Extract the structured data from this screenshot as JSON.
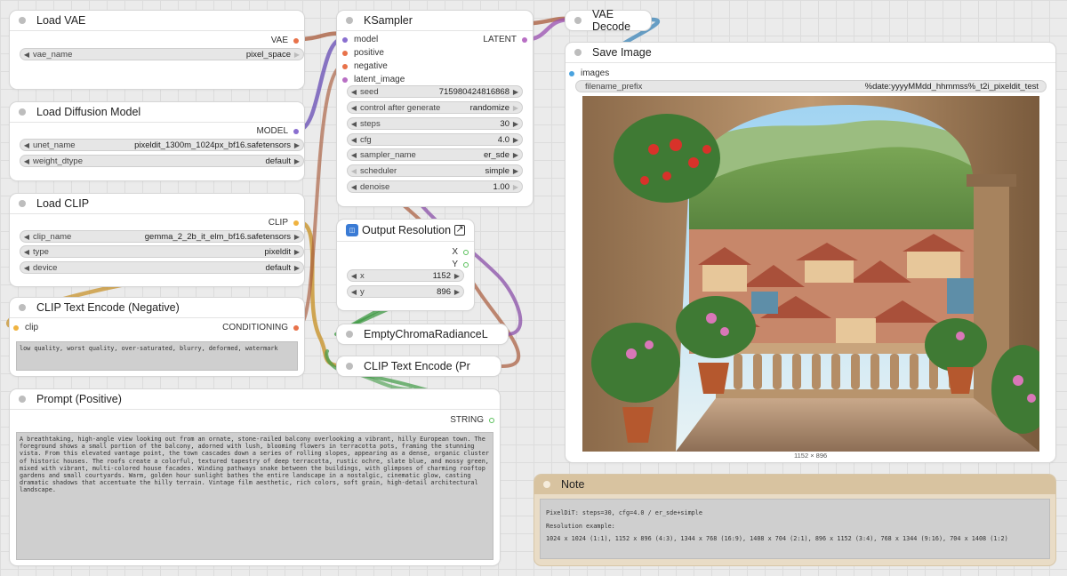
{
  "nodes": {
    "load_vae": {
      "title": "Load VAE",
      "outputs": [
        {
          "label": "VAE",
          "color": "#e8724a"
        }
      ],
      "widgets": [
        {
          "label": "vae_name",
          "value": "pixel_space"
        }
      ]
    },
    "load_diffusion_model": {
      "title": "Load Diffusion Model",
      "outputs": [
        {
          "label": "MODEL",
          "color": "#8a6fd0"
        }
      ],
      "widgets": [
        {
          "label": "unet_name",
          "value": "pixeldit_1300m_1024px_bf16.safetensors"
        },
        {
          "label": "weight_dtype",
          "value": "default"
        }
      ]
    },
    "load_clip": {
      "title": "Load CLIP",
      "outputs": [
        {
          "label": "CLIP",
          "color": "#f0b340"
        }
      ],
      "widgets": [
        {
          "label": "clip_name",
          "value": "gemma_2_2b_it_elm_bf16.safetensors"
        },
        {
          "label": "type",
          "value": "pixeldit"
        },
        {
          "label": "device",
          "value": "default"
        }
      ]
    },
    "clip_text_encode_negative": {
      "title": "CLIP Text Encode (Negative)",
      "inputs": [
        {
          "label": "clip",
          "color": "#f0b340"
        }
      ],
      "outputs": [
        {
          "label": "CONDITIONING",
          "color": "#e8724a"
        }
      ],
      "text": "low quality, worst quality, over-saturated, blurry, deformed, watermark"
    },
    "prompt_positive": {
      "title": "Prompt (Positive)",
      "outputs": [
        {
          "label": "STRING",
          "color": "#59c05a"
        }
      ],
      "text": "A breathtaking, high-angle view looking out from an ornate, stone-railed balcony overlooking a vibrant, hilly European town. The foreground shows a small portion of the balcony, adorned with lush, blooming flowers in terracotta pots, framing the stunning vista. From this elevated vantage point, the town cascades down a series of rolling slopes, appearing as a dense, organic cluster of historic houses. The roofs create a colorful, textured tapestry of deep terracotta, rustic ochre, slate blue, and mossy green, mixed with vibrant, multi-colored house facades. Winding pathways snake between the buildings, with glimpses of charming rooftop gardens and small courtyards. Warm, golden hour sunlight bathes the entire landscape in a nostalgic, cinematic glow, casting dramatic shadows that accentuate the hilly terrain. Vintage film aesthetic, rich colors, soft grain, high-detail architectural landscape."
    },
    "ksampler": {
      "title": "KSampler",
      "inputs": [
        {
          "label": "model",
          "color": "#8a6fd0"
        },
        {
          "label": "positive",
          "color": "#e8724a"
        },
        {
          "label": "negative",
          "color": "#e8724a"
        },
        {
          "label": "latent_image",
          "color": "#b86fc4"
        }
      ],
      "outputs": [
        {
          "label": "LATENT",
          "color": "#b86fc4"
        }
      ],
      "widgets": [
        {
          "label": "seed",
          "value": "715980424816868"
        },
        {
          "label": "control after generate",
          "value": "randomize"
        },
        {
          "label": "steps",
          "value": "30"
        },
        {
          "label": "cfg",
          "value": "4.0"
        },
        {
          "label": "sampler_name",
          "value": "er_sde"
        },
        {
          "label": "scheduler",
          "value": "simple"
        },
        {
          "label": "denoise",
          "value": "1.00"
        }
      ]
    },
    "output_resolution": {
      "title": "Output Resolution",
      "outputs": [
        {
          "label": "X",
          "color": "#59c05a"
        },
        {
          "label": "Y",
          "color": "#59c05a"
        }
      ],
      "widgets": [
        {
          "label": "x",
          "value": "1152"
        },
        {
          "label": "y",
          "value": "896"
        }
      ]
    },
    "empty_latent": {
      "title": "EmptyChromaRadianceL"
    },
    "clip_text_encode_collapsed": {
      "title": "CLIP Text Encode (Pr"
    },
    "vae_decode": {
      "title": "VAE Decode"
    },
    "save_image": {
      "title": "Save Image",
      "inputs": [
        {
          "label": "images",
          "color": "#4aa3df"
        }
      ],
      "widgets": [
        {
          "label": "filename_prefix",
          "value": "%date:yyyyMMdd_hhmmss%_t2i_pixeldit_test"
        }
      ],
      "image_size_label": "1152 × 896"
    },
    "note": {
      "title": "Note",
      "lines": [
        "PixelDiT: steps=30, cfg=4.0 / er_sde+simple",
        "Resolution example:",
        "1024 x 1024 (1:1), 1152 x 896 (4:3), 1344 x 768 (16:9), 1408 x 704 (2:1), 896 x 1152 (3:4), 768 x 1344 (9:16), 704 x 1408 (1:2)"
      ]
    }
  },
  "colors": {
    "canvas": "#ebebeb",
    "wire_model": "#8a6fd0",
    "wire_clip": "#f0b340",
    "wire_conditioning": "#e8724a",
    "wire_latent": "#b86fc4",
    "wire_int": "#59c05a",
    "wire_vae": "#e8724a",
    "wire_image": "#4aa3df"
  }
}
